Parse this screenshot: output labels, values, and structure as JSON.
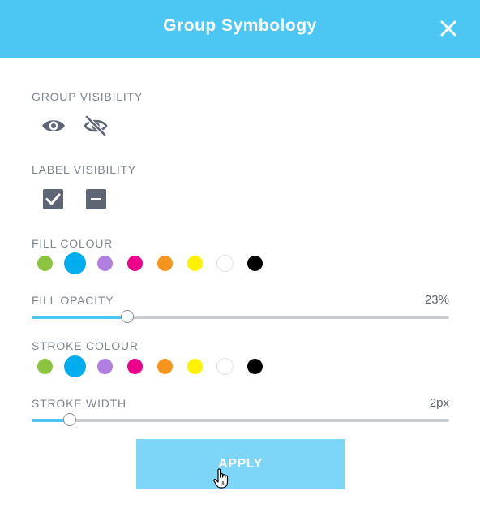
{
  "dialog": {
    "title": "Group Symbology",
    "close_icon": "close-icon"
  },
  "group_visibility": {
    "label": "GROUP VISIBILITY",
    "icons": [
      "eye-icon",
      "eye-off-icon"
    ]
  },
  "label_visibility": {
    "label": "LABEL VISIBILITY",
    "icons": [
      "checkbox-checked-icon",
      "checkbox-indeterminate-icon"
    ]
  },
  "fill_colour": {
    "label": "FILL COLOUR",
    "swatches": [
      "#8cc43f",
      "#00aeef",
      "#b07fe0",
      "#ec008c",
      "#f7941d",
      "#fff200",
      "#ffffff",
      "#000000"
    ],
    "selected_index": 1
  },
  "fill_opacity": {
    "label": "FILL OPACITY",
    "value_text": "23%",
    "value": 23,
    "max": 100
  },
  "stroke_colour": {
    "label": "STROKE COLOUR",
    "swatches": [
      "#8cc43f",
      "#00aeef",
      "#b07fe0",
      "#ec008c",
      "#f7941d",
      "#fff200",
      "#ffffff",
      "#000000"
    ],
    "selected_index": 1
  },
  "stroke_width": {
    "label": "STROKE WIDTH",
    "value_text": "2px",
    "value": 2,
    "max": 22
  },
  "apply_label": "APPLY",
  "colors": {
    "accent": "#4cc6f3",
    "apply_button": "#7dd5f8",
    "icon": "#5e6675"
  }
}
